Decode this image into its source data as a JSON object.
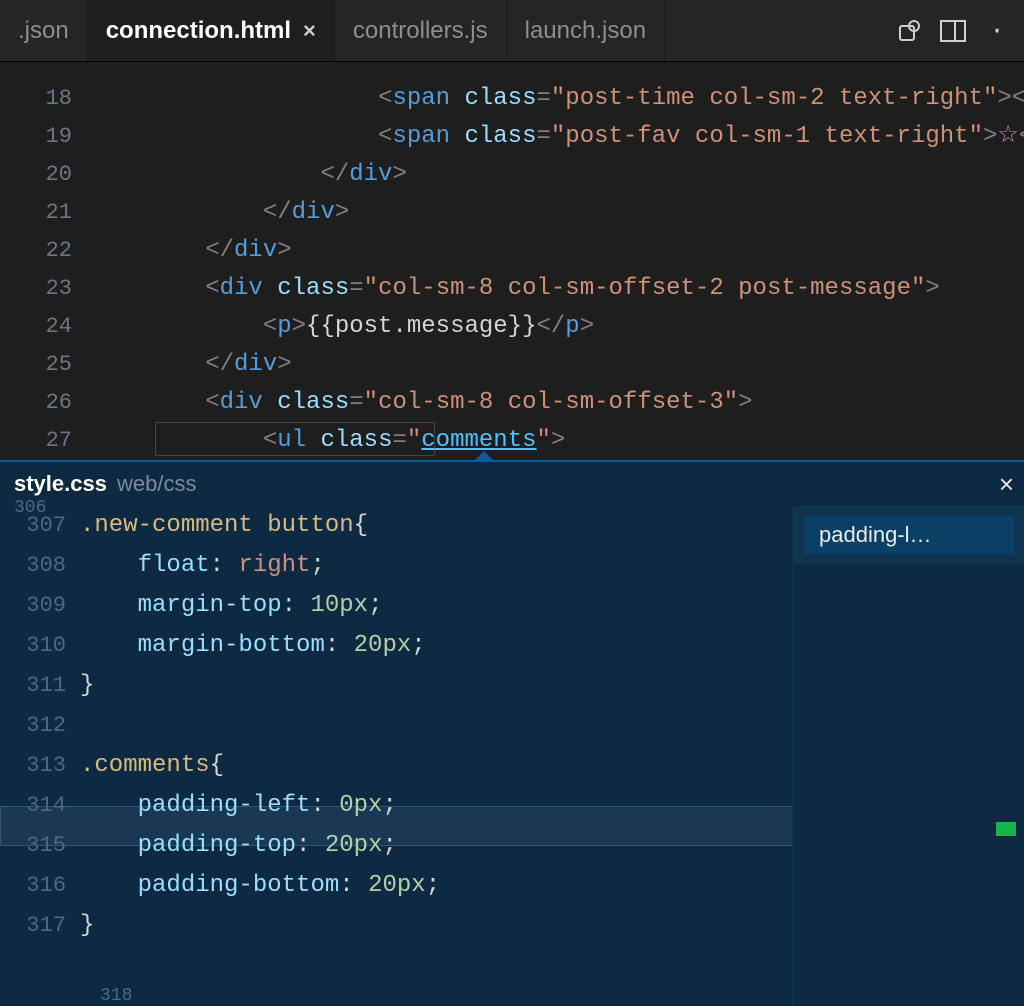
{
  "tabs": {
    "t0": ".json",
    "t1": "connection.html",
    "t2": "controllers.js",
    "t3": "launch.json"
  },
  "upper": {
    "lineStart": 18,
    "lines": {
      "l18": {
        "indent": "                    ",
        "tag": "span",
        "attr": "class",
        "str": "post-time col-sm-2 text-right",
        "trail": "><t"
      },
      "l19": {
        "indent": "                    ",
        "tag": "span",
        "attr": "class",
        "str": "post-fav col-sm-1 text-right",
        "trail": ">☆</"
      },
      "l20": {
        "indent": "                ",
        "closeTag": "div"
      },
      "l21": {
        "indent": "            ",
        "closeTag": "div"
      },
      "l22": {
        "indent": "        ",
        "closeTag": "div"
      },
      "l23": {
        "indent": "        ",
        "tag": "div",
        "attr": "class",
        "str": "col-sm-8 col-sm-offset-2 post-message",
        "trail": ">"
      },
      "l24": {
        "indent": "            ",
        "ptext": "{{post.message}}"
      },
      "l25": {
        "indent": "        ",
        "closeTag": "div"
      },
      "l26": {
        "indent": "        ",
        "tag": "div",
        "attr": "class",
        "str": "col-sm-8 col-sm-offset-3",
        "trail": ">"
      },
      "l27": {
        "indent": "            ",
        "tag": "ul",
        "attr": "class",
        "strlink": "comments",
        "trail": ">"
      }
    }
  },
  "peek": {
    "file": "style.css",
    "path": "web/css",
    "refLabel": "padding-l…",
    "lineStart": 307,
    "truncatedTop": "306",
    "truncatedBottom": "318",
    "lines": {
      "l307": {
        "sel": ".new-comment button",
        "brace": "{"
      },
      "l308": {
        "prop": "float",
        "val": "right"
      },
      "l309": {
        "prop": "margin-top",
        "num": "10",
        "unit": "px"
      },
      "l310": {
        "prop": "margin-bottom",
        "num": "20",
        "unit": "px"
      },
      "l311": {
        "brace": "}"
      },
      "l312": {
        "blank": true
      },
      "l313": {
        "sel": ".comments",
        "brace": "{"
      },
      "l314": {
        "prop": "padding-left",
        "num": "0",
        "unit": "px"
      },
      "l315": {
        "prop": "padding-top",
        "num": "20",
        "unit": "px"
      },
      "l316": {
        "prop": "padding-bottom",
        "num": "20",
        "unit": "px"
      },
      "l317": {
        "brace": "}"
      }
    }
  }
}
